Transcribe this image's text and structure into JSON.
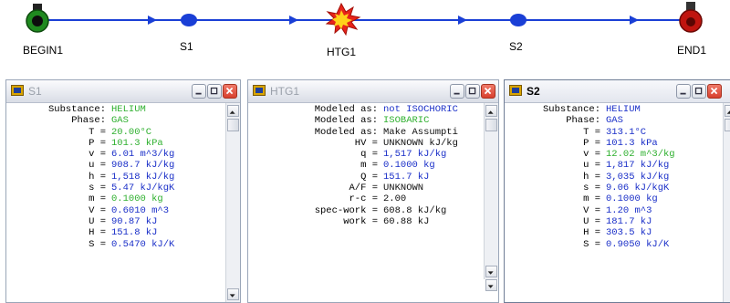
{
  "diagram": {
    "nodes": [
      {
        "id": "begin",
        "label": "BEGIN1"
      },
      {
        "id": "s1",
        "label": "S1"
      },
      {
        "id": "htg",
        "label": "HTG1"
      },
      {
        "id": "s2",
        "label": "S2"
      },
      {
        "id": "end",
        "label": "END1"
      }
    ],
    "line_color": "#1a3fd6",
    "begin_color": "#1f8a1f",
    "end_color": "#c0150f"
  },
  "windows": [
    {
      "title": "S1",
      "rows": [
        {
          "label": "Substance:",
          "value": "HELIUM",
          "given": true
        },
        {
          "label": "Phase:",
          "value": "GAS",
          "given": true
        },
        {
          "label": "T =",
          "value": "20.00°C",
          "given": true
        },
        {
          "label": "P =",
          "value": "101.3 kPa",
          "given": true
        },
        {
          "label": "v =",
          "value": "6.01 m^3/kg",
          "given": false
        },
        {
          "label": "u =",
          "value": "908.7 kJ/kg",
          "given": false
        },
        {
          "label": "h =",
          "value": "1,518 kJ/kg",
          "given": false
        },
        {
          "label": "s =",
          "value": "5.47 kJ/kgK",
          "given": false
        },
        {
          "label": "m =",
          "value": "0.1000 kg",
          "given": true
        },
        {
          "label": "V =",
          "value": "0.6010 m^3",
          "given": false
        },
        {
          "label": "U =",
          "value": "90.87 kJ",
          "given": false
        },
        {
          "label": "H =",
          "value": "151.8 kJ",
          "given": false
        },
        {
          "label": "S =",
          "value": "0.5470 kJ/K",
          "given": false
        }
      ]
    },
    {
      "title": "HTG1",
      "rows": [
        {
          "label": "Modeled as:",
          "value": "not ISOCHORIC",
          "given": false
        },
        {
          "label": "Modeled as:",
          "value": "ISOBARIC",
          "given": true
        },
        {
          "label": "Modeled as:",
          "value": "Make Assumpti",
          "given": false,
          "plain": true
        },
        {
          "label": "HV =",
          "value": "UNKNOWN kJ/kg",
          "given": false,
          "plain": true
        },
        {
          "label": "q =",
          "value": "1,517 kJ/kg",
          "given": false
        },
        {
          "label": "m =",
          "value": "0.1000 kg",
          "given": false
        },
        {
          "label": "Q =",
          "value": "151.7 kJ",
          "given": false
        },
        {
          "label": "A/F =",
          "value": "UNKNOWN",
          "given": false,
          "plain": true
        },
        {
          "label": "r-c =",
          "value": "2.00",
          "given": false,
          "plain": true
        },
        {
          "label": "spec-work =",
          "value": "608.8 kJ/kg",
          "given": false,
          "plain": true
        },
        {
          "label": "work =",
          "value": "60.88 kJ",
          "given": false,
          "plain": true
        }
      ]
    },
    {
      "title": "S2",
      "rows": [
        {
          "label": "Substance:",
          "value": "HELIUM",
          "given": false
        },
        {
          "label": "Phase:",
          "value": "GAS",
          "given": false
        },
        {
          "label": "T =",
          "value": "313.1°C",
          "given": false
        },
        {
          "label": "P =",
          "value": "101.3 kPa",
          "given": false
        },
        {
          "label": "v =",
          "value": "12.02 m^3/kg",
          "given": true
        },
        {
          "label": "u =",
          "value": "1,817 kJ/kg",
          "given": false
        },
        {
          "label": "h =",
          "value": "3,035 kJ/kg",
          "given": false
        },
        {
          "label": "s =",
          "value": "9.06 kJ/kgK",
          "given": false
        },
        {
          "label": "m =",
          "value": "0.1000 kg",
          "given": false
        },
        {
          "label": "V =",
          "value": "1.20 m^3",
          "given": false
        },
        {
          "label": "U =",
          "value": "181.7 kJ",
          "given": false
        },
        {
          "label": "H =",
          "value": "303.5 kJ",
          "given": false
        },
        {
          "label": "S =",
          "value": "0.9050 kJ/K",
          "given": false
        }
      ]
    }
  ]
}
